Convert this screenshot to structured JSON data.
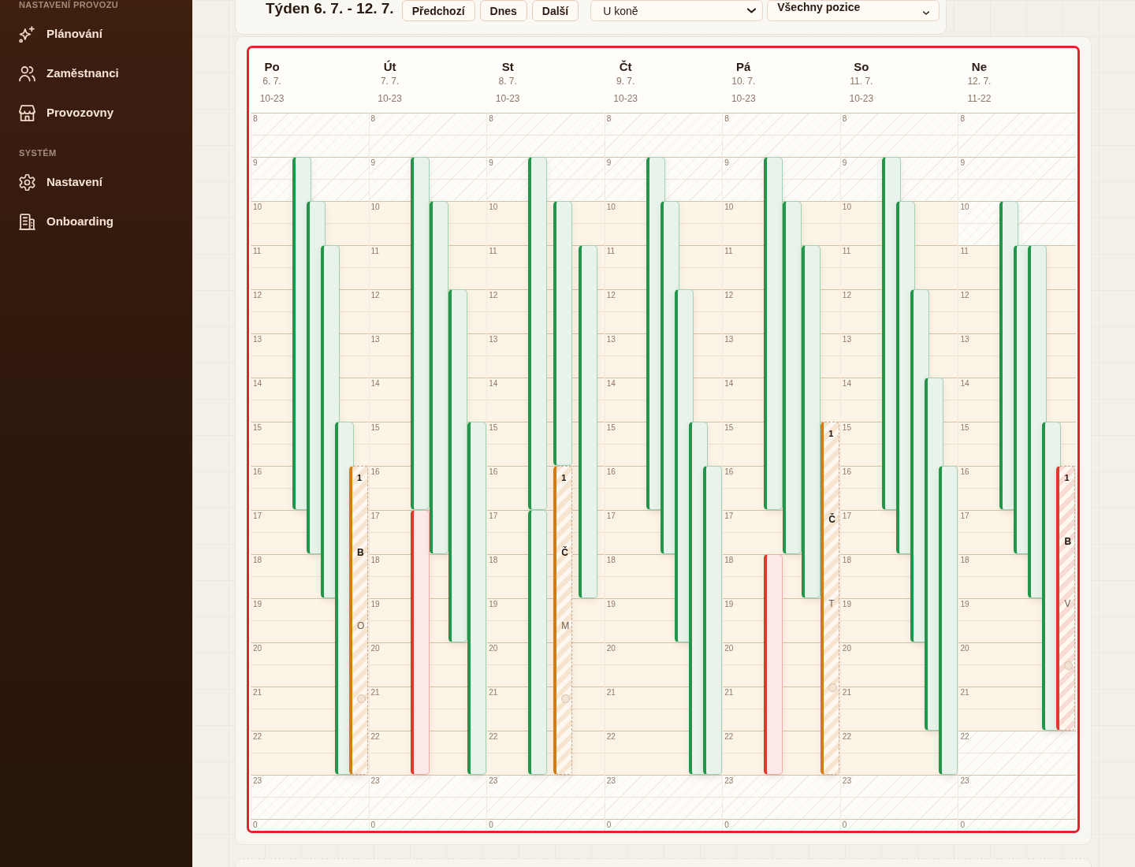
{
  "sidebar": {
    "sections": [
      {
        "heading": "NASTAVENÍ PROVOZU",
        "items": [
          {
            "label": "Plánování"
          },
          {
            "label": "Zaměstnanci"
          },
          {
            "label": "Provozovny"
          }
        ]
      },
      {
        "heading": "SYSTÉM",
        "items": [
          {
            "label": "Nastavení"
          },
          {
            "label": "Onboarding"
          }
        ]
      }
    ]
  },
  "toolbar": {
    "title": "Týden 6. 7. - 12. 7.",
    "buttons": [
      "Předchozí",
      "Dnes",
      "Další"
    ],
    "filters": [
      {
        "kind": "select",
        "value": "U koně"
      },
      {
        "kind": "dropdown",
        "value": "Všechny pozice"
      }
    ]
  },
  "calendar": {
    "days": [
      {
        "name": "Po",
        "date": "6. 7.",
        "hours": "10-23",
        "hour_labels": [
          "8",
          "9",
          "10",
          "11",
          "12",
          "13",
          "14",
          "15",
          "16",
          "17",
          "18",
          "19",
          "20",
          "21",
          "22",
          "23",
          "0"
        ],
        "shifts": [
          {
            "kind": "shift",
            "color": "#22954a"
          },
          {
            "kind": "shift",
            "color": "#22954a"
          },
          {
            "kind": "shift",
            "color": "#22954a"
          },
          {
            "kind": "shift",
            "color": "#22954a"
          },
          {
            "kind": "open",
            "color": "#d17d17",
            "time": "1",
            "name": "B",
            "role": "O"
          }
        ]
      },
      {
        "name": "Út",
        "date": "7. 7.",
        "hours": "10-23",
        "hour_labels": [
          "8",
          "9",
          "10",
          "11",
          "12",
          "13",
          "14",
          "15",
          "16",
          "17",
          "18",
          "19",
          "20",
          "21",
          "22",
          "23",
          "0"
        ],
        "shifts": [
          {
            "kind": "shift",
            "color": "#22954a"
          },
          {
            "kind": "shift",
            "color": "#e0392b"
          },
          {
            "kind": "shift",
            "color": "#22954a"
          },
          {
            "kind": "shift",
            "color": "#22954a"
          },
          {
            "kind": "shift",
            "color": "#22954a"
          }
        ]
      },
      {
        "name": "St",
        "date": "8. 7.",
        "hours": "10-23",
        "hour_labels": [
          "8",
          "9",
          "10",
          "11",
          "12",
          "13",
          "14",
          "15",
          "16",
          "17",
          "18",
          "19",
          "20",
          "21",
          "22",
          "23",
          "0"
        ],
        "shifts": [
          {
            "kind": "shift",
            "color": "#22954a"
          },
          {
            "kind": "shift",
            "color": "#22954a"
          },
          {
            "kind": "shift",
            "color": "#22954a"
          },
          {
            "kind": "open",
            "color": "#d17d17",
            "time": "1",
            "name": "Č",
            "role": "M"
          },
          {
            "kind": "shift",
            "color": "#22954a"
          }
        ]
      },
      {
        "name": "Čt",
        "date": "9. 7.",
        "hours": "10-23",
        "hour_labels": [
          "8",
          "9",
          "10",
          "11",
          "12",
          "13",
          "14",
          "15",
          "16",
          "17",
          "18",
          "19",
          "20",
          "21",
          "22",
          "23",
          "0"
        ],
        "shifts": [
          {
            "kind": "shift",
            "color": "#22954a"
          },
          {
            "kind": "shift",
            "color": "#22954a"
          },
          {
            "kind": "shift",
            "color": "#22954a"
          },
          {
            "kind": "shift",
            "color": "#22954a"
          },
          {
            "kind": "shift",
            "color": "#22954a"
          }
        ]
      },
      {
        "name": "Pá",
        "date": "10. 7.",
        "hours": "10-23",
        "hour_labels": [
          "8",
          "9",
          "10",
          "11",
          "12",
          "13",
          "14",
          "15",
          "16",
          "17",
          "18",
          "19",
          "20",
          "21",
          "22",
          "23",
          "0"
        ],
        "shifts": [
          {
            "kind": "shift",
            "color": "#22954a"
          },
          {
            "kind": "shift",
            "color": "#e0392b"
          },
          {
            "kind": "shift",
            "color": "#22954a"
          },
          {
            "kind": "shift",
            "color": "#22954a"
          },
          {
            "kind": "open",
            "color": "#d17d17",
            "time": "1",
            "name": "Č",
            "role": "T"
          }
        ]
      },
      {
        "name": "So",
        "date": "11. 7.",
        "hours": "10-23",
        "hour_labels": [
          "8",
          "9",
          "10",
          "11",
          "12",
          "13",
          "14",
          "15",
          "16",
          "17",
          "18",
          "19",
          "20",
          "21",
          "22",
          "23",
          "0"
        ],
        "shifts": [
          {
            "kind": "shift",
            "color": "#22954a"
          },
          {
            "kind": "shift",
            "color": "#22954a"
          },
          {
            "kind": "shift",
            "color": "#22954a"
          },
          {
            "kind": "shift",
            "color": "#22954a"
          },
          {
            "kind": "shift",
            "color": "#22954a"
          }
        ]
      },
      {
        "name": "Ne",
        "date": "12. 7.",
        "hours": "11-22",
        "hour_labels": [
          "8",
          "9",
          "10",
          "11",
          "12",
          "13",
          "14",
          "15",
          "16",
          "17",
          "18",
          "19",
          "20",
          "21",
          "22",
          "23",
          "0"
        ],
        "shifts": [
          {
            "kind": "shift",
            "color": "#22954a"
          },
          {
            "kind": "shift",
            "color": "#22954a"
          },
          {
            "kind": "shift",
            "color": "#22954a"
          },
          {
            "kind": "shift",
            "color": "#22954a"
          },
          {
            "kind": "open",
            "color": "#e0392b",
            "time": "1",
            "name": "B",
            "role": "V"
          }
        ]
      }
    ]
  }
}
